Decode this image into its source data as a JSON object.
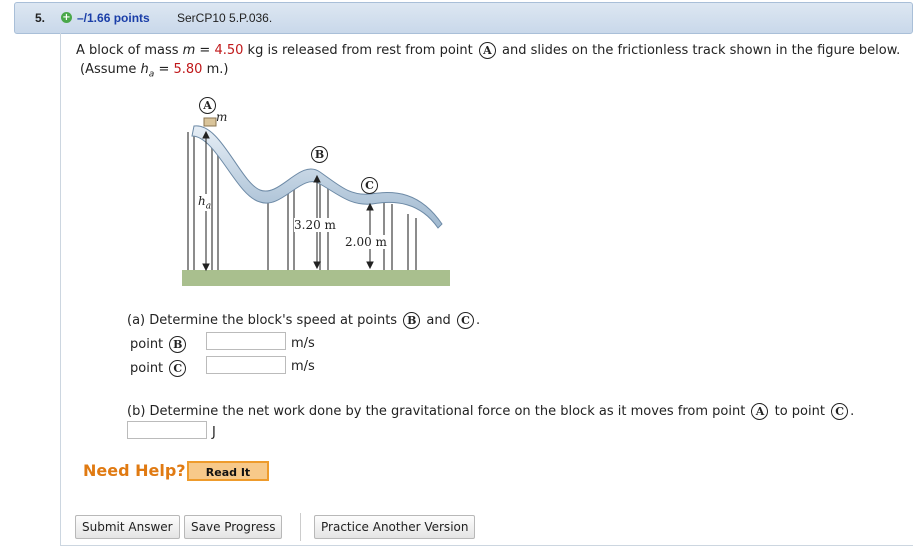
{
  "header": {
    "question_number": "5.",
    "points": "–/1.66 points",
    "problem_code": "SerCP10 5.P.036."
  },
  "problem": {
    "line1_a": "A block of mass ",
    "mass_var": "m",
    "line1_eq": " = ",
    "mass_value": "4.50",
    "line1_b": " kg  is released from rest from point ",
    "point_a": "A",
    "line1_c": " and slides on the frictionless track shown in the figure below.",
    "line2_a": "(Assume ",
    "h_var": "h",
    "h_sub": "a",
    "line2_eq": " = ",
    "h_value": "5.80",
    "line2_b": " m.)"
  },
  "figure": {
    "label_a": "A",
    "label_b": "B",
    "label_c": "C",
    "label_m": "m",
    "label_h": "h",
    "label_h_sub": "a",
    "height_b": "3.20 m",
    "height_c": "2.00 m"
  },
  "part_a": {
    "prompt": "(a) Determine the block's speed at points ",
    "and": " and ",
    "end": ".",
    "rows": [
      {
        "label": "point",
        "point": "B",
        "unit": "m/s",
        "value": ""
      },
      {
        "label": "point",
        "point": "C",
        "unit": "m/s",
        "value": ""
      }
    ]
  },
  "part_b": {
    "prompt": "(b) Determine the net work done by the gravitational force on the block as it moves from point ",
    "to": " to point ",
    "end": ".",
    "unit": "J",
    "value": ""
  },
  "help": {
    "need_help": "Need Help?",
    "read_it": "Read It"
  },
  "buttons": {
    "submit": "Submit Answer",
    "save": "Save Progress",
    "practice": "Practice Another Version"
  }
}
